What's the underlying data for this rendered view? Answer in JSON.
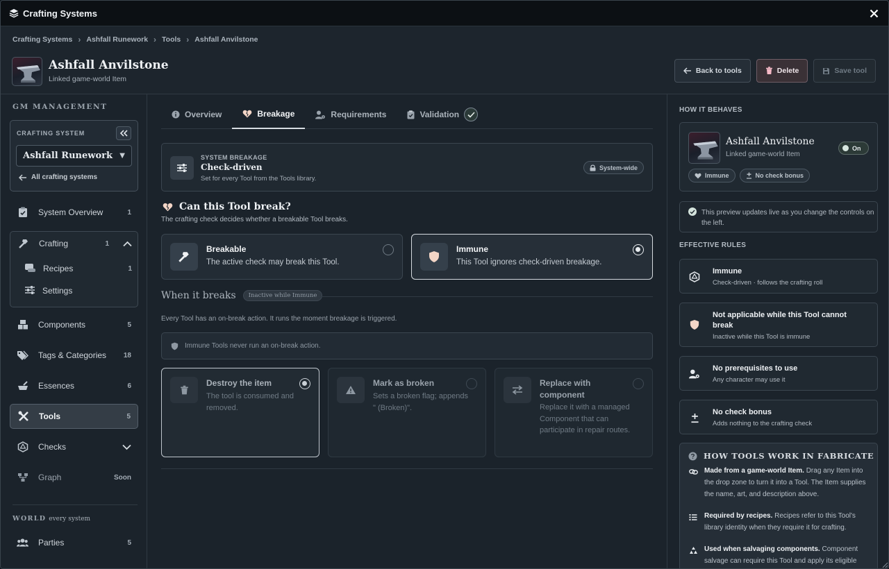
{
  "window": {
    "title": "Crafting Systems"
  },
  "breadcrumb": [
    "Crafting Systems",
    "Ashfall Runework",
    "Tools",
    "Ashfall Anvilstone"
  ],
  "header": {
    "title": "Ashfall Anvilstone",
    "subtitle": "Linked game-world Item",
    "back_label": "Back to tools",
    "delete_label": "Delete",
    "save_label": "Save tool"
  },
  "sidebar": {
    "heading": "GM MANAGEMENT",
    "crafting_system_label": "CRAFTING SYSTEM",
    "selected_system": "Ashfall Runework",
    "all_systems_link": "All crafting systems",
    "items": [
      {
        "label": "System Overview",
        "count": "1",
        "icon": "clipboard-icon"
      },
      {
        "label": "Crafting",
        "count": "1",
        "icon": "hammer-icon"
      },
      {
        "label": "Recipes",
        "count": "1",
        "icon": "scroll-icon"
      },
      {
        "label": "Settings",
        "count": "",
        "icon": "sliders-icon"
      },
      {
        "label": "Components",
        "count": "5",
        "icon": "boxes-icon"
      },
      {
        "label": "Tags & Categories",
        "count": "18",
        "icon": "tags-icon"
      },
      {
        "label": "Essences",
        "count": "6",
        "icon": "mortar-icon"
      },
      {
        "label": "Tools",
        "count": "5",
        "icon": "tools-icon"
      },
      {
        "label": "Checks",
        "count": "",
        "icon": "dice-icon"
      },
      {
        "label": "Graph",
        "count": "Soon",
        "icon": "graph-icon"
      }
    ],
    "world_label": "WORLD",
    "world_sub": "every system",
    "parties": {
      "label": "Parties",
      "count": "5",
      "icon": "users-icon"
    }
  },
  "tabs": [
    {
      "label": "Overview",
      "icon": "info-icon"
    },
    {
      "label": "Breakage",
      "icon": "heart-crack-icon"
    },
    {
      "label": "Requirements",
      "icon": "user-gear-icon"
    },
    {
      "label": "Validation",
      "icon": "clipboard-check-icon"
    }
  ],
  "system_breakage": {
    "kicker": "SYSTEM BREAKAGE",
    "title": "Check-driven",
    "desc": "Set for every Tool from the Tools library.",
    "pill": "System-wide"
  },
  "can_break": {
    "title": "Can this Tool break?",
    "sub": "The crafting check decides whether a breakable Tool breaks.",
    "options": [
      {
        "title": "Breakable",
        "desc": "The active check may break this Tool.",
        "selected": false
      },
      {
        "title": "Immune",
        "desc": "This Tool ignores check-driven breakage.",
        "selected": true
      }
    ]
  },
  "when_breaks": {
    "title": "When it breaks",
    "badge": "Inactive while Immune",
    "sub": "Every Tool has an on-break action. It runs the moment breakage is triggered.",
    "notice": "Immune Tools never run an on-break action.",
    "actions": [
      {
        "title": "Destroy the item",
        "desc": "The tool is consumed and removed.",
        "selected": true
      },
      {
        "title": "Mark as broken",
        "desc": "Sets a broken flag; appends \" (Broken)\".",
        "selected": false
      },
      {
        "title": "Replace with component",
        "desc": "Replace it with a managed Component that can participate in repair routes.",
        "selected": false
      }
    ]
  },
  "right": {
    "how_behaves": "HOW IT BEHAVES",
    "preview_name": "Ashfall Anvilstone",
    "preview_sub": "Linked game-world Item",
    "toggle_label": "On",
    "chips": [
      "Immune",
      "No check bonus"
    ],
    "live_note": "This preview updates live as you change the controls on the left.",
    "effective_rules_heading": "EFFECTIVE RULES",
    "rules": [
      {
        "title": "Immune",
        "desc": "Check-driven · follows the crafting roll"
      },
      {
        "title": "Not applicable while this Tool cannot break",
        "desc": "Inactive while this Tool is immune"
      },
      {
        "title": "No prerequisites to use",
        "desc": "Any character may use it"
      },
      {
        "title": "No check bonus",
        "desc": "Adds nothing to the crafting check"
      }
    ],
    "how_tools_heading": "HOW TOOLS WORK IN FABRICATE",
    "how_items": [
      {
        "lead": "Made from a game-world Item.",
        "text": " Drag any Item into the drop zone to turn it into a Tool. The Item supplies the name, art, and description above."
      },
      {
        "lead": "Required by recipes.",
        "text": " Recipes refer to this Tool's library identity when they require it for crafting."
      },
      {
        "lead": "Used when salvaging components.",
        "text": " Component salvage can require this Tool and apply its eligible checks."
      }
    ]
  }
}
